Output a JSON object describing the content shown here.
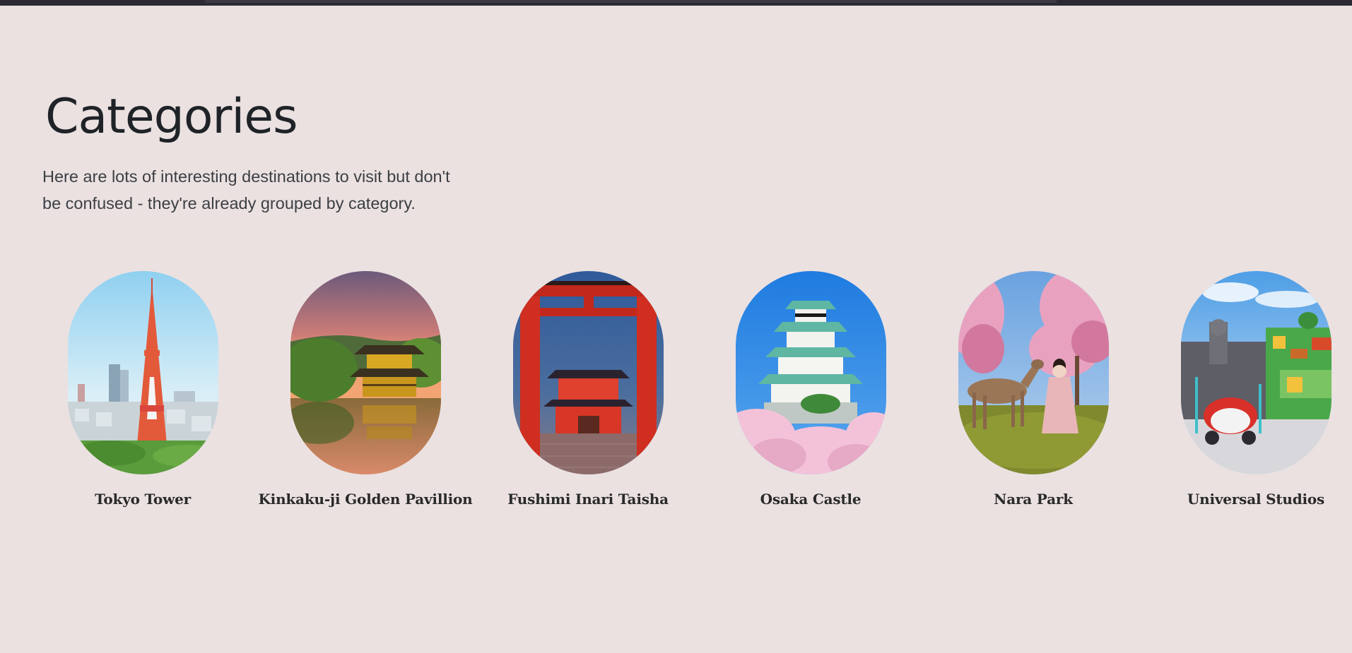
{
  "header": {
    "title": "Categories",
    "intro_line1": "Here are lots of interesting destinations to visit but don't",
    "intro_line2": "be confused - they're already grouped by category."
  },
  "categories": [
    {
      "label": "Tokyo Tower",
      "icon": "tokyo-tower-photo"
    },
    {
      "label": "Kinkaku-ji Golden Pavillion",
      "icon": "golden-pavilion-photo"
    },
    {
      "label": "Fushimi Inari Taisha",
      "icon": "torii-gate-photo"
    },
    {
      "label": "Osaka Castle",
      "icon": "castle-photo"
    },
    {
      "label": "Nara Park",
      "icon": "deer-park-photo"
    },
    {
      "label": "Universal Studios",
      "icon": "theme-park-photo"
    }
  ],
  "colors": {
    "background": "#ebe1e1",
    "topbar": "#2b2a33",
    "text": "#212529"
  }
}
